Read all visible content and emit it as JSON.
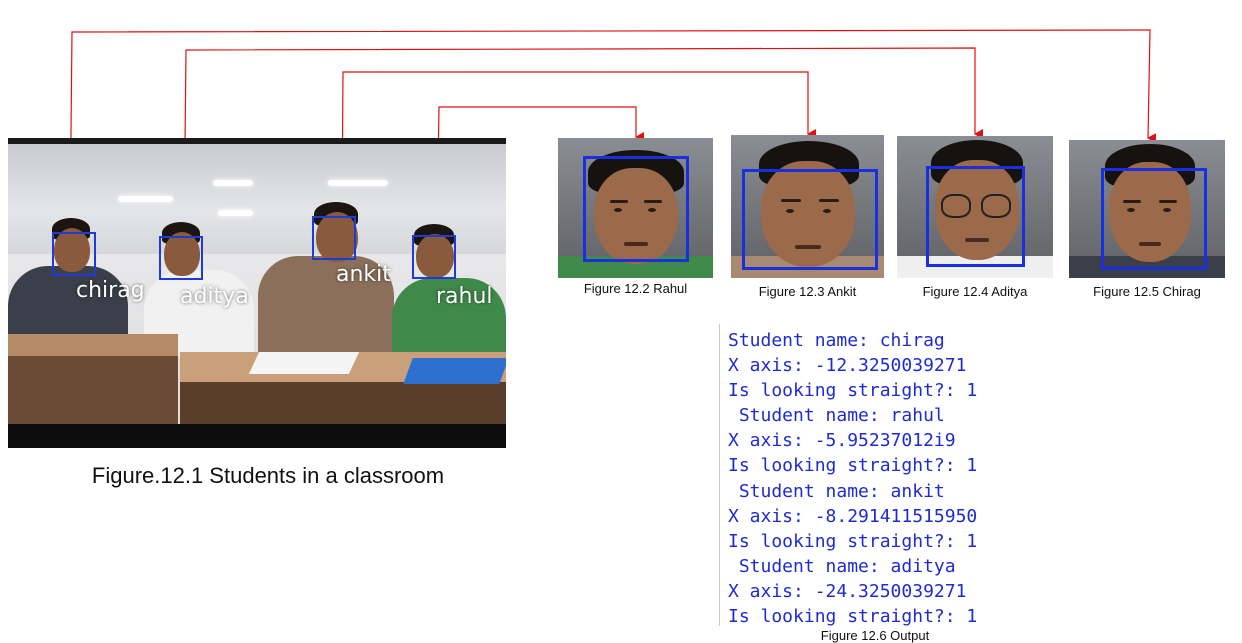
{
  "main_figure": {
    "caption": "Figure.12.1 Students in a classroom",
    "labels": [
      "chirag",
      "aditya",
      "ankit",
      "rahul"
    ]
  },
  "thumbnails": [
    {
      "caption": "Figure 12.2 Rahul"
    },
    {
      "caption": "Figure 12.3 Ankit"
    },
    {
      "caption": "Figure 12.4 Aditya"
    },
    {
      "caption": "Figure 12.5 Chirag"
    }
  ],
  "output": {
    "caption": "Figure 12.6 Output",
    "lines": [
      "Student name: chirag",
      "X axis: -12.3250039271",
      "Is looking straight?: 1",
      " Student name: rahul",
      "X axis: -5.95237012i9",
      "Is looking straight?: 1",
      " Student name: ankit",
      "X axis: -8.291411515950",
      "Is looking straight?: 1",
      " Student name: aditya",
      "X axis: -24.3250039271",
      "Is looking straight?: 1"
    ]
  },
  "colors": {
    "connector": "#e01010",
    "face_box": "#1f3bd6",
    "console_text": "#1d2bd6"
  }
}
